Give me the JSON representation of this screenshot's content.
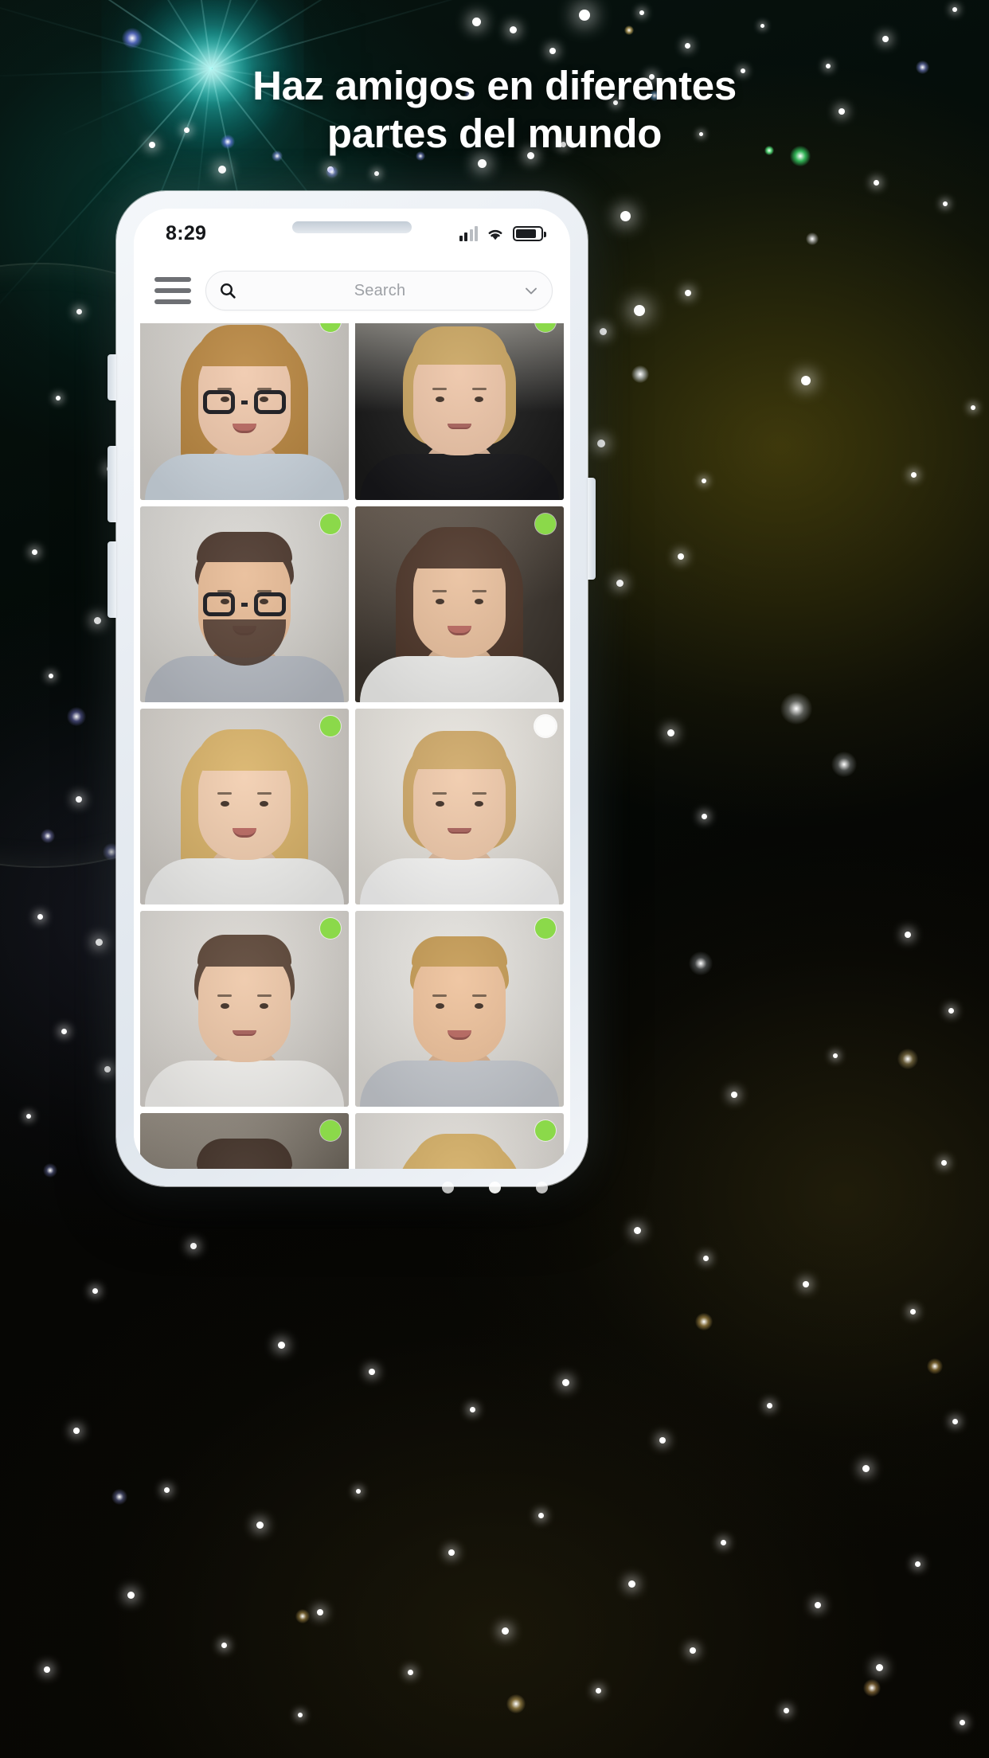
{
  "promo": {
    "headline_line1": "Haz amigos en diferentes",
    "headline_line2": "partes del mundo",
    "text_color": "#ffffff",
    "accent_color": "#2ee6dc",
    "background_colors": [
      "#071410",
      "#040b08",
      "#080703"
    ]
  },
  "phone": {
    "status_bar": {
      "time": "8:29",
      "signal_icon": "signal-bars-icon",
      "wifi_icon": "wifi-icon",
      "battery_icon": "battery-icon",
      "battery_level_percent": 82
    },
    "app_bar": {
      "menu_icon": "hamburger-menu-icon",
      "search": {
        "icon": "search-icon",
        "placeholder": "Search",
        "value": "",
        "dropdown_icon": "chevron-down-icon"
      }
    },
    "grid": {
      "columns": 2,
      "online_color": "#8bd94a",
      "offline_color": "#ffffff",
      "cards": [
        {
          "name": "user-card-1",
          "status": "online",
          "status_label": "Online",
          "photo": "woman-glasses-blonde"
        },
        {
          "name": "user-card-2",
          "status": "online",
          "status_label": "Online",
          "photo": "woman-black-turtleneck"
        },
        {
          "name": "user-card-3",
          "status": "online",
          "status_label": "Online",
          "photo": "man-glasses-beard"
        },
        {
          "name": "user-card-4",
          "status": "online",
          "status_label": "Online",
          "photo": "woman-brunette-cafe"
        },
        {
          "name": "user-card-5",
          "status": "online",
          "status_label": "Online",
          "photo": "woman-blonde-white-top"
        },
        {
          "name": "user-card-6",
          "status": "offline",
          "status_label": "Offline",
          "photo": "woman-blonde-shirt-room"
        },
        {
          "name": "user-card-7",
          "status": "online",
          "status_label": "Online",
          "photo": "woman-brunette-hands"
        },
        {
          "name": "user-card-8",
          "status": "online",
          "status_label": "Online",
          "photo": "man-blond-brick-wall"
        },
        {
          "name": "user-card-9",
          "status": "online",
          "status_label": "Online",
          "photo": "man-stripe-shirt-smile"
        },
        {
          "name": "user-card-10",
          "status": "online",
          "status_label": "Online",
          "photo": "woman-blonde-white-dress"
        }
      ]
    },
    "home_indicator": "home-indicator"
  },
  "pager": {
    "dots": 3,
    "active_index": 1
  }
}
